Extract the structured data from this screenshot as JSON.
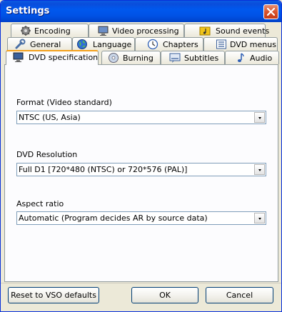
{
  "window": {
    "title": "Settings"
  },
  "tabs": {
    "row1": [
      {
        "label": "Encoding",
        "icon": "gear-icon"
      },
      {
        "label": "Video processing",
        "icon": "monitor-icon"
      },
      {
        "label": "Sound events",
        "icon": "folder-note-icon"
      }
    ],
    "row2": [
      {
        "label": "General",
        "icon": "wrench-icon"
      },
      {
        "label": "Language",
        "icon": "globe-icon"
      },
      {
        "label": "Chapters",
        "icon": "clock-icon"
      },
      {
        "label": "DVD menus",
        "icon": "menu-icon"
      }
    ],
    "row3": [
      {
        "label": "DVD specification",
        "icon": "monitor-icon",
        "active": true
      },
      {
        "label": "Burning",
        "icon": "disc-icon"
      },
      {
        "label": "Subtitles",
        "icon": "subtitle-icon"
      },
      {
        "label": "Audio",
        "icon": "music-note-icon"
      }
    ]
  },
  "form": {
    "format": {
      "label": "Format (Video standard)",
      "value": "NTSC (US, Asia)"
    },
    "resolution": {
      "label": "DVD Resolution",
      "value": "Full D1 [720*480 (NTSC) or 720*576 (PAL)]"
    },
    "aspect": {
      "label": "Aspect ratio",
      "value": "Automatic (Program decides AR by source data)"
    }
  },
  "buttons": {
    "reset": "Reset to VSO defaults",
    "ok": "OK",
    "cancel": "Cancel"
  },
  "colors": {
    "titlebar": "#0054e3",
    "active_tab_accent": "#f5a11c",
    "close_button": "#d8532d"
  }
}
